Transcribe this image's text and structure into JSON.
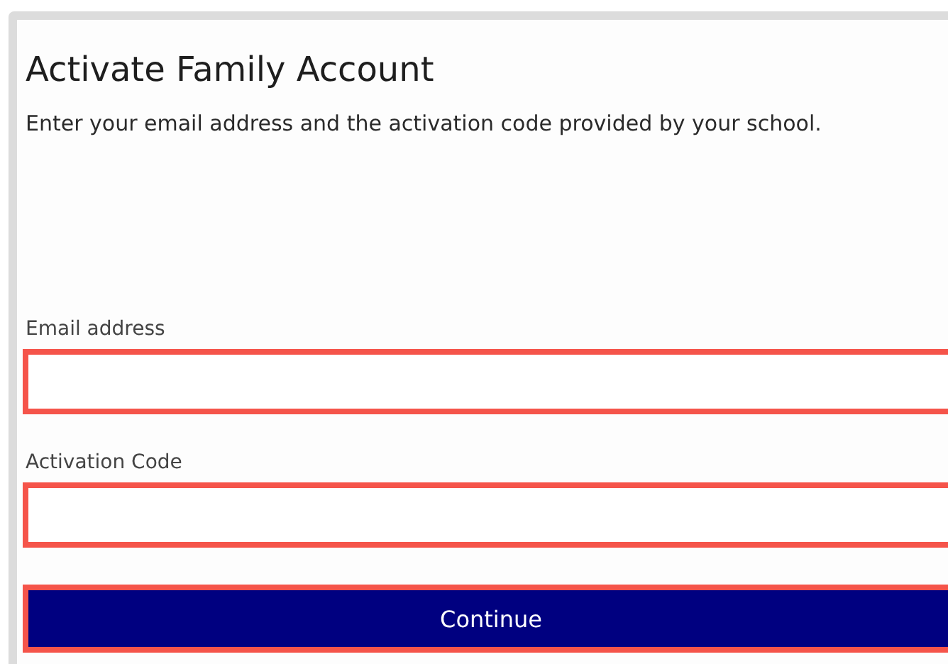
{
  "title": "Activate Family Account",
  "description": "Enter your email address and the activation code provided by your school.",
  "fields": [
    {
      "label": "Email address",
      "invalid": true
    },
    {
      "label": "Activation Code",
      "invalid": true
    }
  ],
  "button": {
    "label": "Continue",
    "outlined": true
  }
}
